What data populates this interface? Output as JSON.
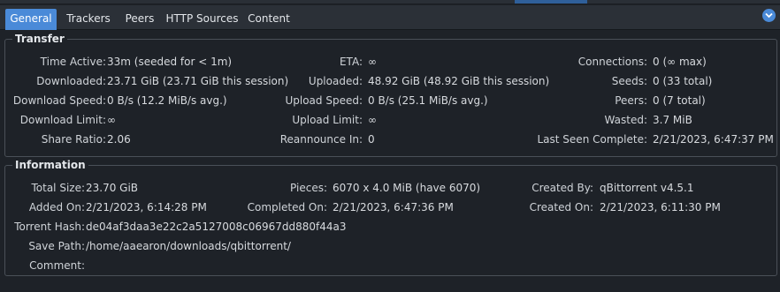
{
  "tabs": [
    {
      "label": "General",
      "active": true
    },
    {
      "label": "Trackers",
      "active": false
    },
    {
      "label": "Peers",
      "active": false
    },
    {
      "label": "HTTP Sources",
      "active": false
    },
    {
      "label": "Content",
      "active": false
    }
  ],
  "colors": {
    "accent": "#4a8ad8",
    "background": "#1e2228",
    "border": "#4a5058"
  },
  "collapse_icon": "chevron-down-icon",
  "transfer": {
    "title": "Transfer",
    "time_active": {
      "label": "Time Active:",
      "value": "33m (seeded for < 1m)"
    },
    "downloaded": {
      "label": "Downloaded:",
      "value": "23.71 GiB (23.71 GiB this session)"
    },
    "download_speed": {
      "label": "Download Speed:",
      "value": "0 B/s (12.2 MiB/s avg.)"
    },
    "download_limit": {
      "label": "Download Limit:",
      "value": "∞"
    },
    "share_ratio": {
      "label": "Share Ratio:",
      "value": "2.06"
    },
    "eta": {
      "label": "ETA:",
      "value": "∞"
    },
    "uploaded": {
      "label": "Uploaded:",
      "value": "48.92 GiB (48.92 GiB this session)"
    },
    "upload_speed": {
      "label": "Upload Speed:",
      "value": "0 B/s (25.1 MiB/s avg.)"
    },
    "upload_limit": {
      "label": "Upload Limit:",
      "value": "∞"
    },
    "reannounce": {
      "label": "Reannounce In:",
      "value": "0"
    },
    "connections": {
      "label": "Connections:",
      "value": "0 (∞ max)"
    },
    "seeds": {
      "label": "Seeds:",
      "value": "0 (33 total)"
    },
    "peers": {
      "label": "Peers:",
      "value": "0 (7 total)"
    },
    "wasted": {
      "label": "Wasted:",
      "value": "3.7 MiB"
    },
    "last_seen": {
      "label": "Last Seen Complete:",
      "value": "2/21/2023, 6:47:37 PM"
    }
  },
  "information": {
    "title": "Information",
    "total_size": {
      "label": "Total Size:",
      "value": "23.70 GiB"
    },
    "added_on": {
      "label": "Added On:",
      "value": "2/21/2023, 6:14:28 PM"
    },
    "torrent_hash": {
      "label": "Torrent Hash:",
      "value": "de04af3daa3e22c2a5127008c06967dd880f44a3"
    },
    "save_path": {
      "label": "Save Path:",
      "value": "/home/aaearon/downloads/qbittorrent/"
    },
    "comment": {
      "label": "Comment:",
      "value": ""
    },
    "pieces": {
      "label": "Pieces:",
      "value": "6070 x 4.0 MiB (have 6070)"
    },
    "completed_on": {
      "label": "Completed On:",
      "value": "2/21/2023, 6:47:36 PM"
    },
    "created_by": {
      "label": "Created By:",
      "value": "qBittorrent v4.5.1"
    },
    "created_on": {
      "label": "Created On:",
      "value": "2/21/2023, 6:11:30 PM"
    }
  }
}
